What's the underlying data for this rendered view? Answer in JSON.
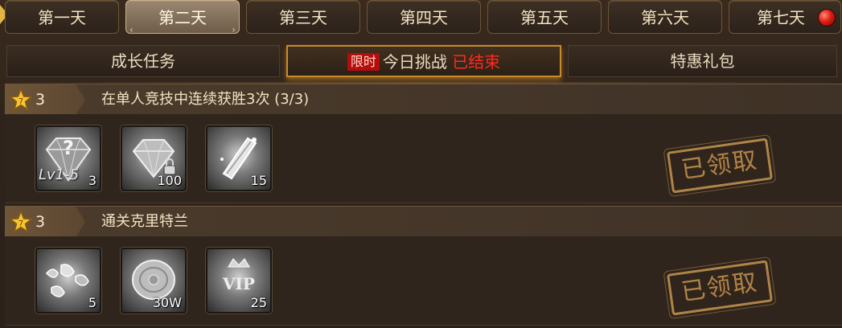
{
  "days": [
    {
      "label": "第一天",
      "active": false
    },
    {
      "label": "第二天",
      "active": true
    },
    {
      "label": "第三天",
      "active": false
    },
    {
      "label": "第四天",
      "active": false
    },
    {
      "label": "第五天",
      "active": false
    },
    {
      "label": "第六天",
      "active": false
    },
    {
      "label": "第七天",
      "active": false,
      "notification": true
    }
  ],
  "subtabs": {
    "growth": "成长任务",
    "challenge_badge": "限时",
    "challenge": "今日挑战",
    "challenge_status": "已结束",
    "gift": "特惠礼包"
  },
  "tasks": [
    {
      "stars": "3",
      "title": "在单人竞技中连续获胜3次 (3/3)",
      "rewards": [
        {
          "icon": "mystery-gem-icon",
          "label": "Lv1-5",
          "qty": "3"
        },
        {
          "icon": "bound-diamond-icon",
          "qty": "100"
        },
        {
          "icon": "crystal-shard-icon",
          "qty": "15"
        }
      ],
      "status": "已领取"
    },
    {
      "stars": "3",
      "title": "通关克里特兰",
      "rewards": [
        {
          "icon": "rune-fragments-icon",
          "qty": "5"
        },
        {
          "icon": "coin-icon",
          "qty": "30W"
        },
        {
          "icon": "vip-icon",
          "qty": "25"
        }
      ],
      "status": "已领取"
    }
  ],
  "colors": {
    "accent_gold": "#c88b2a",
    "status_red": "#ff2a1f",
    "stamp": "#b8884a"
  }
}
